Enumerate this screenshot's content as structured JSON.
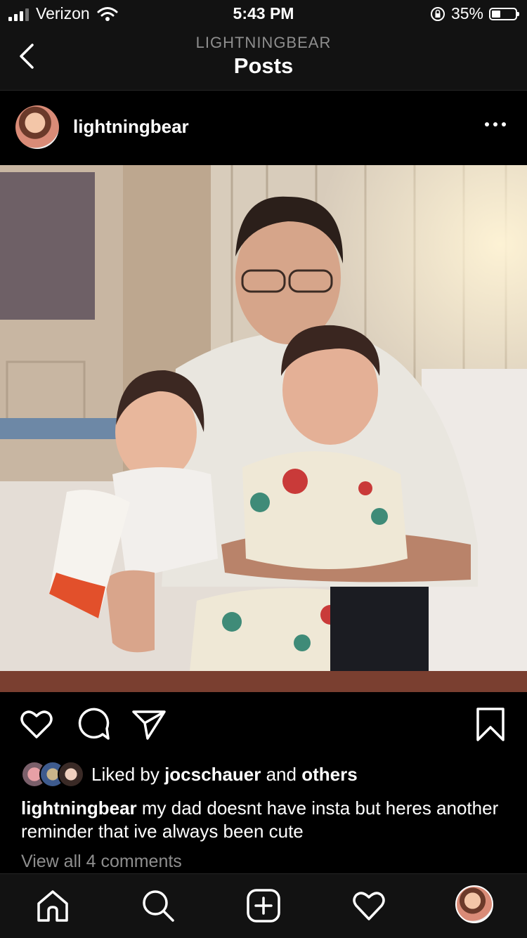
{
  "status_bar": {
    "carrier": "Verizon",
    "time": "5:43 PM",
    "battery": "35%"
  },
  "nav": {
    "subtitle": "LIGHTNINGBEAR",
    "title": "Posts"
  },
  "post": {
    "username": "lightningbear",
    "likes": {
      "prefix": "Liked by ",
      "user": "jocschauer",
      "middle": " and ",
      "others": "others"
    },
    "caption": {
      "username": "lightningbear",
      "text": " my dad doesnt have insta but heres another reminder that ive always been cute"
    },
    "view_comments": "View all 4 comments"
  },
  "icons": {
    "back": "chevron-left-icon",
    "more": "more-horizontal-icon",
    "like": "heart-icon",
    "comment": "comment-icon",
    "share": "send-icon",
    "save": "bookmark-icon",
    "home": "home-icon",
    "search": "search-icon",
    "new_post": "plus-square-icon",
    "activity": "heart-icon"
  }
}
